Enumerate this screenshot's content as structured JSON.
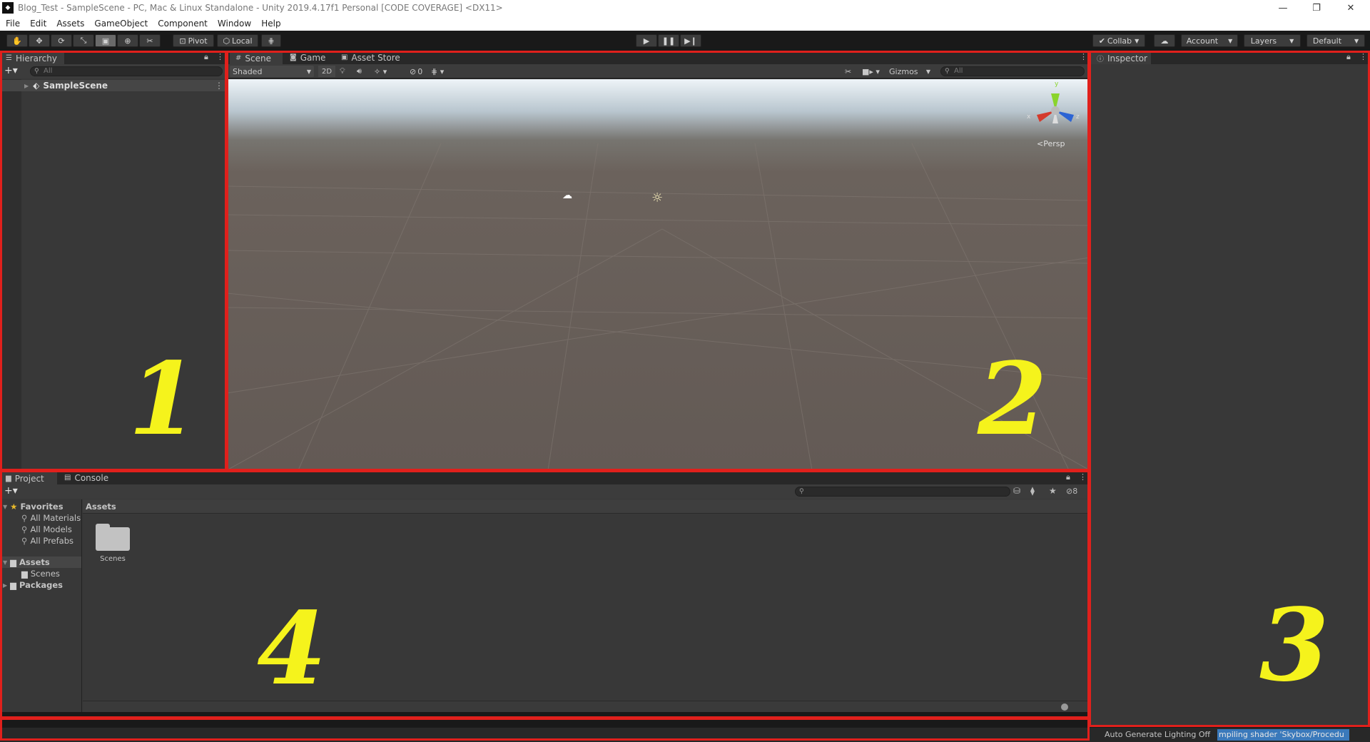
{
  "window": {
    "title": "Blog_Test - SampleScene - PC, Mac & Linux Standalone - Unity 2019.4.17f1 Personal [CODE COVERAGE] <DX11>",
    "app_icon": "unity-logo",
    "minimize": "—",
    "restore": "❐",
    "close": "✕"
  },
  "menu": [
    "File",
    "Edit",
    "Assets",
    "GameObject",
    "Component",
    "Window",
    "Help"
  ],
  "toolbar": {
    "tools": [
      "hand-tool",
      "move-tool",
      "rotate-tool",
      "scale-tool",
      "rect-tool",
      "transform-tool",
      "custom-tool"
    ],
    "pivot_label": "Pivot",
    "local_label": "Local",
    "collab_label": "Collab",
    "account_label": "Account",
    "layers_label": "Layers",
    "layout_label": "Default"
  },
  "hierarchy": {
    "tab_label": "Hierarchy",
    "search_placeholder": "All",
    "scene_item": "SampleScene"
  },
  "scene": {
    "tabs": [
      "Scene",
      "Game",
      "Asset Store"
    ],
    "shading_mode": "Shaded",
    "mode_2d": "2D",
    "hidden_count": "0",
    "gizmos_label": "Gizmos",
    "search_placeholder": "All",
    "persp_label": "Persp",
    "axis_x": "x",
    "axis_z": "z",
    "axis_y": "y"
  },
  "inspector": {
    "tab_label": "Inspector"
  },
  "project": {
    "tabs": [
      "Project",
      "Console"
    ],
    "favorites_label": "Favorites",
    "favorites": [
      "All Materials",
      "All Models",
      "All Prefabs"
    ],
    "assets_label": "Assets",
    "assets_children": [
      "Scenes"
    ],
    "packages_label": "Packages",
    "breadcrumb": "Assets",
    "hidden_packages_count": "8",
    "grid_items": [
      "Scenes"
    ]
  },
  "status": {
    "lighting": "Auto Generate Lighting Off",
    "progress": "mpiling shader 'Skybox/Procedu"
  },
  "annotations": [
    "1",
    "2",
    "3",
    "4"
  ],
  "colors": {
    "highlight": "#e0201c",
    "annotation": "#f5f31c",
    "accent": "#3a79bb"
  }
}
